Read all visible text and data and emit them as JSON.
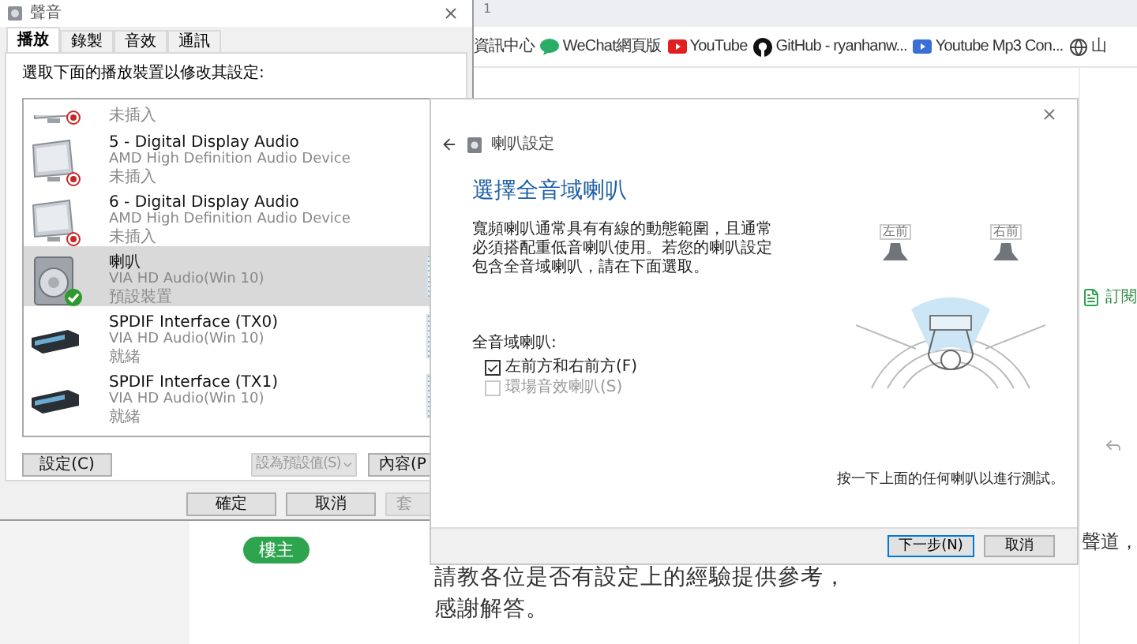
{
  "browser": {
    "tab_text": "1",
    "bookmarks": [
      {
        "label": "資訊中心",
        "kind": "plain"
      },
      {
        "label": "WeChat網頁版",
        "kind": "wechat"
      },
      {
        "label": "YouTube",
        "kind": "youtube"
      },
      {
        "label": "GitHub - ryanhanw...",
        "kind": "github"
      },
      {
        "label": "Youtube Mp3 Con...",
        "kind": "video"
      },
      {
        "label": "山",
        "kind": "globe"
      }
    ]
  },
  "post": {
    "badge": "樓主",
    "cut_line": "聲道，",
    "lines": [
      "請教各位是否有設定上的經驗提供參考，",
      "感謝解答。"
    ],
    "subscribe": "訂閱"
  },
  "sound_dialog": {
    "title": "聲音",
    "tabs": [
      {
        "label": "播放",
        "selected": true
      },
      {
        "label": "錄製",
        "selected": false
      },
      {
        "label": "音效",
        "selected": false
      },
      {
        "label": "通訊",
        "selected": false
      }
    ],
    "instruction": "選取下面的播放裝置以修改其設定:",
    "devices": [
      {
        "kind": "monitor",
        "status": "未插入",
        "plugged": false,
        "default": false,
        "selected": false,
        "partial": true
      },
      {
        "kind": "monitor",
        "name": "5 - Digital Display Audio",
        "driver": "AMD High Definition Audio Device",
        "status": "未插入",
        "plugged": false,
        "default": false,
        "selected": false
      },
      {
        "kind": "monitor",
        "name": "6 - Digital Display Audio",
        "driver": "AMD High Definition Audio Device",
        "status": "未插入",
        "plugged": false,
        "default": false,
        "selected": false
      },
      {
        "kind": "speaker",
        "name": "喇叭",
        "driver": "VIA HD Audio(Win 10)",
        "status": "預設裝置",
        "plugged": true,
        "default": true,
        "selected": true
      },
      {
        "kind": "spdif",
        "name": "SPDIF Interface (TX0)",
        "driver": "VIA HD Audio(Win 10)",
        "status": "就緒",
        "plugged": true,
        "default": false,
        "selected": false
      },
      {
        "kind": "spdif",
        "name": "SPDIF Interface (TX1)",
        "driver": "VIA HD Audio(Win 10)",
        "status": "就緒",
        "plugged": true,
        "default": false,
        "selected": false
      }
    ],
    "configure_button": {
      "label": "設定(C)",
      "disabled": false
    },
    "set_default_button": {
      "label": "設為預設值(S)",
      "disabled": true
    },
    "properties_button": {
      "label": "內容(P",
      "disabled": false
    },
    "footer_buttons": [
      {
        "label": "確定",
        "disabled": false
      },
      {
        "label": "取消",
        "disabled": false
      },
      {
        "label": "套",
        "disabled": true
      }
    ]
  },
  "speaker_setup": {
    "title": "喇叭設定",
    "heading": "選擇全音域喇叭",
    "description": "寬頻喇叭通常具有有線的動態範圍，且通常必須搭配重低音喇叭使用。若您的喇叭設定包含全音域喇叭，請在下面選取。",
    "group_label": "全音域喇叭:",
    "options": [
      {
        "label": "左前方和右前方(F)",
        "checked": true,
        "disabled": false
      },
      {
        "label": "環場音效喇叭(S)",
        "checked": false,
        "disabled": true
      }
    ],
    "speakers": [
      {
        "label": "左前"
      },
      {
        "label": "右前"
      }
    ],
    "hint": "按一下上面的任何喇叭以進行測試。",
    "buttons": [
      {
        "label": "下一步(N)",
        "default": true
      },
      {
        "label": "取消",
        "default": false
      }
    ]
  }
}
